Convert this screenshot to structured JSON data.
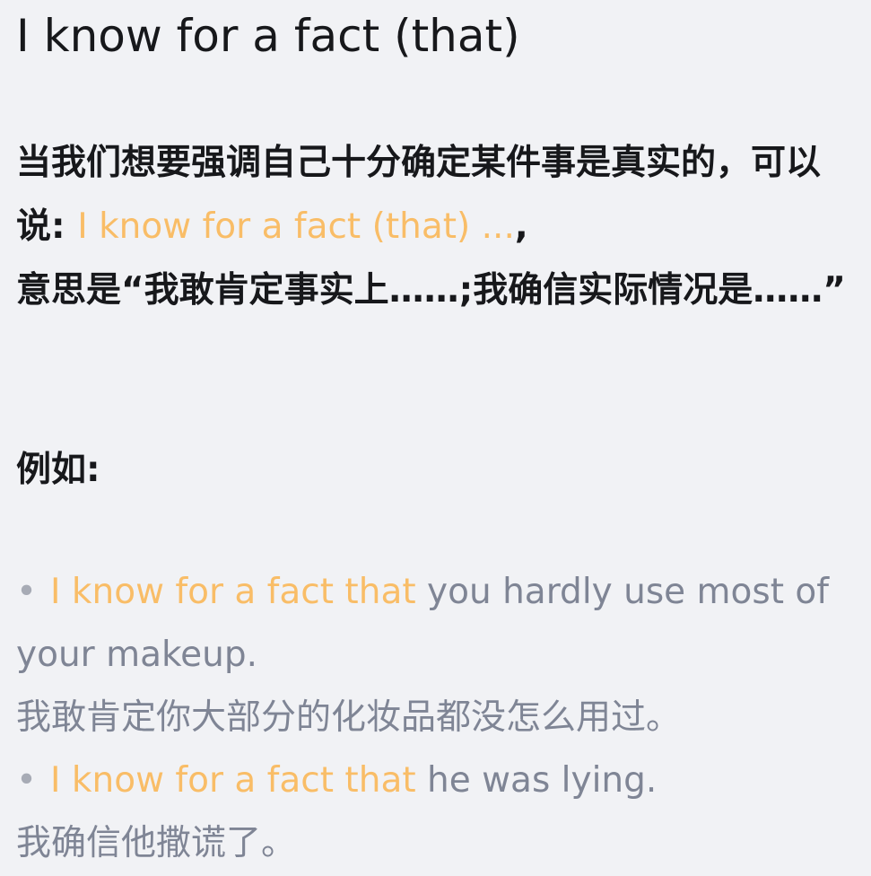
{
  "title": "I know for a fact (that)",
  "intro": {
    "lead_text": "当我们想要强调自己十分确定某件事是真实的，可以说: ",
    "highlight_phrase": "I know for a fact (that) ...",
    "comma": ",",
    "meaning_text": "意思是“我敢肯定事实上……;我确信实际情况是……”"
  },
  "example_label": "例如:",
  "examples": [
    {
      "bullet": "•",
      "highlight": "I know for a fact that",
      "english_rest": " you hardly use most of your makeup.",
      "translation": "我敢肯定你大部分的化妆品都没怎么用过。"
    },
    {
      "bullet": "•",
      "highlight": "I know for a fact that",
      "english_rest": " he was lying.",
      "translation": "我确信他撒谎了。"
    }
  ],
  "colors": {
    "background": "#f1f2f5",
    "primary_text": "#17181b",
    "highlight": "#f9bd67",
    "example_text": "#7f8595"
  }
}
